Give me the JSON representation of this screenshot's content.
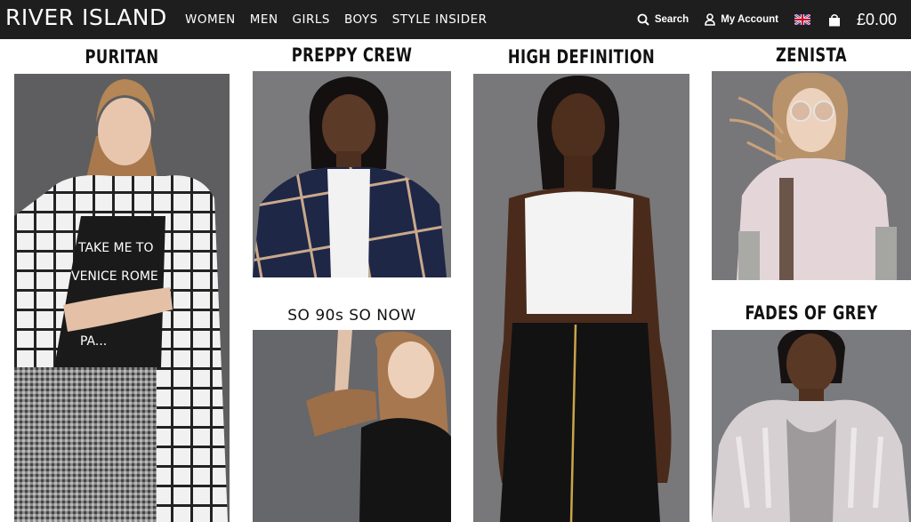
{
  "header": {
    "logo": "RIVER ISLAND",
    "nav": [
      "WOMEN",
      "MEN",
      "GIRLS",
      "BOYS",
      "STYLE INSIDER"
    ],
    "search_label": "Search",
    "account_label": "My Account",
    "basket_total": "£0.00"
  },
  "trends": [
    {
      "title": "PURITAN",
      "shirt_text": "TAKE ME TO\nVENICE ROME\nPA..."
    },
    {
      "title": "PREPPY CREW"
    },
    {
      "title": "HIGH DEFINITION"
    },
    {
      "title": "ZENISTA"
    },
    {
      "title": "SO 90s SO NOW"
    },
    {
      "title": "FADES OF GREY"
    }
  ],
  "colors": {
    "header_bg": "#1e1e1e",
    "tile_bg": "#5a5a5c",
    "text": "#111111"
  }
}
